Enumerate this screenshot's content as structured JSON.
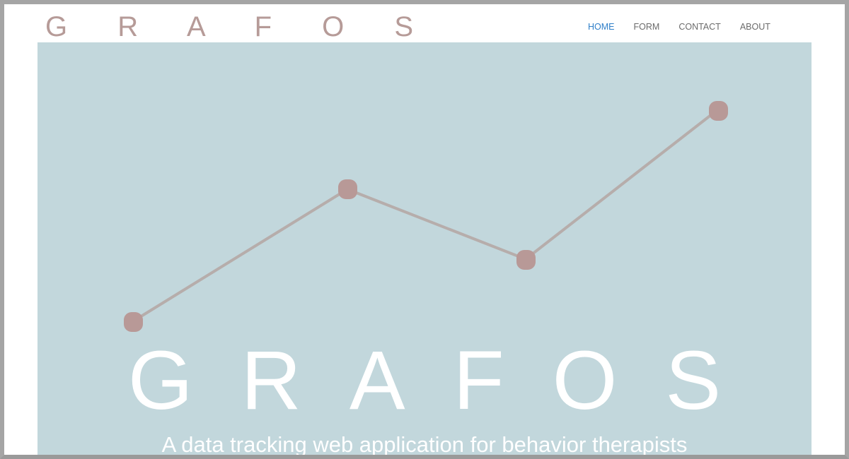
{
  "header": {
    "logo": "G R A F O S"
  },
  "nav": {
    "items": [
      {
        "label": "HOME",
        "active": true
      },
      {
        "label": "FORM",
        "active": false
      },
      {
        "label": "CONTACT",
        "active": false
      },
      {
        "label": "ABOUT",
        "active": false
      }
    ]
  },
  "hero": {
    "title": "GRAFOS",
    "subtitle": "A data tracking web application for behavior therapists",
    "graphic": {
      "points": 4,
      "line_color": "#b6adab",
      "point_color": "#b89997"
    }
  },
  "colors": {
    "logo": "#b69b98",
    "nav_active": "#2f7fc9",
    "nav_default": "#6b6b6b",
    "hero_background": "#c2d7dc",
    "hero_text": "#ffffff"
  }
}
